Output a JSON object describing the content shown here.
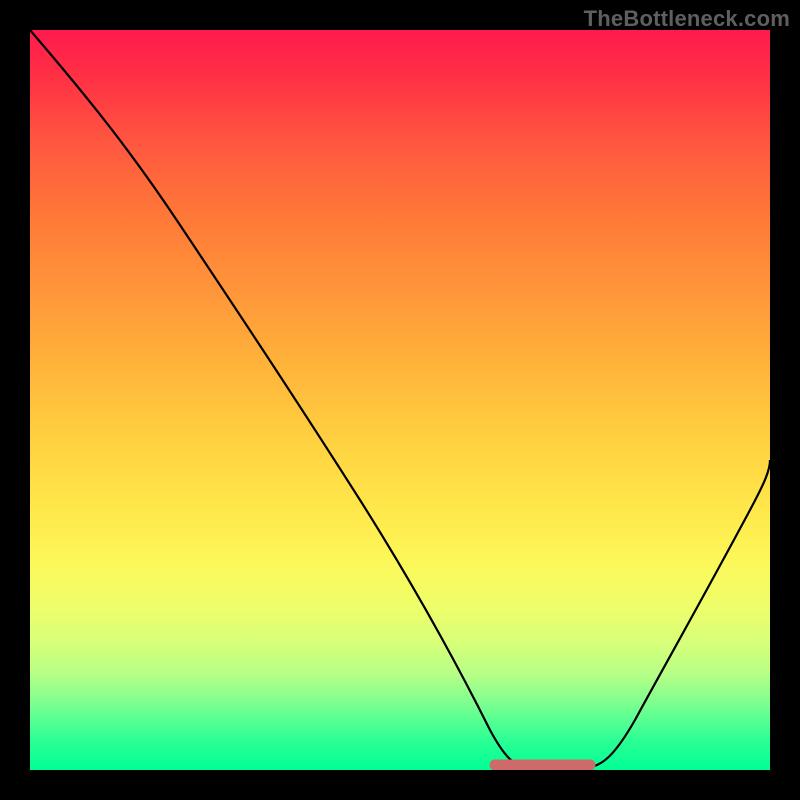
{
  "watermark": "TheBottleneck.com",
  "chart_data": {
    "type": "line",
    "title": "",
    "xlabel": "",
    "ylabel": "",
    "xlim": [
      0,
      100
    ],
    "ylim": [
      0,
      100
    ],
    "background_gradient": {
      "top_color": "#ff1a4d",
      "bottom_color": "#00ff96",
      "meaning": "severity / bottleneck percent (red = high, green = low)"
    },
    "series": [
      {
        "name": "bottleneck-curve",
        "color": "#000000",
        "x": [
          0,
          6,
          12,
          18,
          24,
          30,
          36,
          42,
          48,
          54,
          58,
          62,
          66,
          70,
          74,
          78,
          82,
          86,
          90,
          94,
          100
        ],
        "y": [
          100,
          93,
          85,
          77,
          69,
          61,
          52,
          43,
          34,
          24,
          16,
          8,
          2,
          0,
          0,
          2,
          9,
          18,
          27,
          35,
          48
        ]
      },
      {
        "name": "optimal-range-marker",
        "color": "#d06a6a",
        "x": [
          62,
          76
        ],
        "y": [
          0,
          0
        ]
      }
    ],
    "grid": false,
    "legend": false
  }
}
